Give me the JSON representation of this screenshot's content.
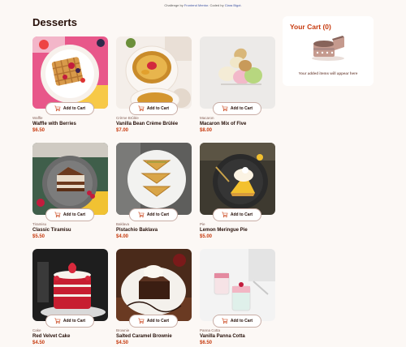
{
  "attribution": {
    "prefix": "Challenge by",
    "challenge_link": "Frontend Mentor",
    "middle": ". Coded by",
    "author_link": "Clara Bigot",
    "suffix": "."
  },
  "page": {
    "title": "Desserts"
  },
  "products": [
    {
      "category": "Waffle",
      "name": "Waffle with Berries",
      "price": "$6.50",
      "add_label": "Add to Cart"
    },
    {
      "category": "Crème Brûlée",
      "name": "Vanilla Bean Crème Brûlée",
      "price": "$7.00",
      "add_label": "Add to Cart"
    },
    {
      "category": "Macaron",
      "name": "Macaron Mix of Five",
      "price": "$8.00",
      "add_label": "Add to Cart"
    },
    {
      "category": "Tiramisu",
      "name": "Classic Tiramisu",
      "price": "$5.50",
      "add_label": "Add to Cart"
    },
    {
      "category": "Baklava",
      "name": "Pistachio Baklava",
      "price": "$4.00",
      "add_label": "Add to Cart"
    },
    {
      "category": "Pie",
      "name": "Lemon Meringue Pie",
      "price": "$5.00",
      "add_label": "Add to Cart"
    },
    {
      "category": "Cake",
      "name": "Red Velvet Cake",
      "price": "$4.50",
      "add_label": "Add to Cart"
    },
    {
      "category": "Brownie",
      "name": "Salted Caramel Brownie",
      "price": "$4.50",
      "add_label": "Add to Cart"
    },
    {
      "category": "Panna Cotta",
      "name": "Vanilla Panna Cotta",
      "price": "$6.50",
      "add_label": "Add to Cart"
    }
  ],
  "cart": {
    "title": "Your Cart (0)",
    "empty_message": "Your added items will appear here"
  },
  "colors": {
    "accent": "#c73b0f",
    "text": "#260f08",
    "muted": "#87635a",
    "background": "#fcf8f5"
  },
  "icons": {
    "add_to_cart": "cart-plus-icon",
    "empty_cart": "empty-cake-illustration"
  }
}
